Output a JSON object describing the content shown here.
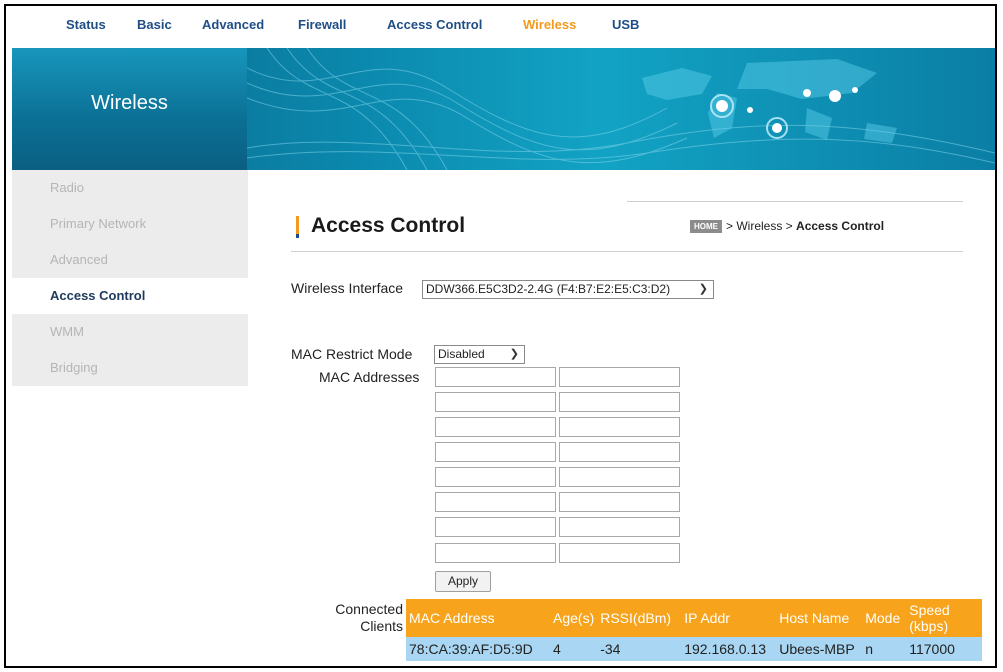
{
  "nav": {
    "items": [
      "Status",
      "Basic",
      "Advanced",
      "Firewall",
      "Access Control",
      "Wireless",
      "USB"
    ],
    "active": "Wireless"
  },
  "banner": {
    "title": "Wireless"
  },
  "sidebar": {
    "items": [
      "Radio",
      "Primary Network",
      "Advanced",
      "Access Control",
      "WMM",
      "Bridging"
    ],
    "active": "Access Control"
  },
  "page": {
    "title": "Access Control",
    "breadcrumb": {
      "home": "HOME",
      "path": "> Wireless > ",
      "current": "Access Control"
    }
  },
  "form": {
    "wireless_interface_label": "Wireless Interface",
    "wireless_interface_value": "DDW366.E5C3D2-2.4G (F4:B7:E2:E5:C3:D2)",
    "mac_restrict_label": "MAC Restrict Mode",
    "mac_restrict_value": "Disabled",
    "mac_addresses_label": "MAC Addresses",
    "apply_label": "Apply"
  },
  "clients": {
    "label_line1": "Connected",
    "label_line2": "Clients",
    "headers": [
      "MAC Address",
      "Age(s)",
      "RSSI(dBm)",
      "IP Addr",
      "Host Name",
      "Mode",
      "Speed (kbps)"
    ],
    "rows": [
      [
        "78:CA:39:AF:D5:9D",
        "4",
        "-34",
        "192.168.0.13",
        "Ubees-MBP",
        "n",
        "117000"
      ]
    ]
  },
  "colors": {
    "accent": "#f39a1e",
    "nav_blue": "#1f4e86",
    "table_header": "#f7a31c",
    "table_row": "#a9d6f2"
  }
}
